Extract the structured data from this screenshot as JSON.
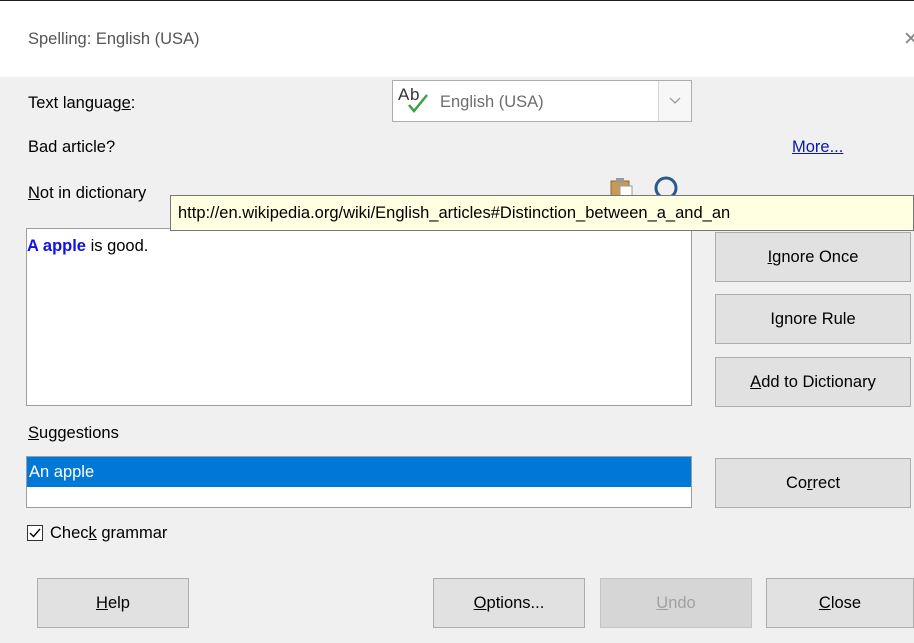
{
  "window": {
    "title": "Spelling: English (USA)",
    "close_glyph": "✕"
  },
  "text_language": {
    "label_pre": "Text languag",
    "label_u": "e",
    "label_post": ":",
    "value": "English (USA)",
    "icon": "spellcheck-abc-icon"
  },
  "error_desc": "Bad article?",
  "more_link": "More...",
  "not_in_dictionary": {
    "label_u": "N",
    "label_rest": "ot in dictionary"
  },
  "toolbar_icons": [
    "paste-icon",
    "search-icon"
  ],
  "editor": {
    "error_text": "A apple",
    "rest_text": " is good."
  },
  "tooltip": "http://en.wikipedia.org/wiki/English_articles#Distinction_between_a_and_an",
  "side_buttons": {
    "ignore_once": {
      "u": "I",
      "rest": "gnore Once"
    },
    "ignore_rule": {
      "pre": "I",
      "u": "g",
      "rest": "nore Rule"
    },
    "add_dictionary": {
      "u": "A",
      "rest": "dd to Dictionary"
    },
    "correct": {
      "pre": "Co",
      "u": "r",
      "rest": "rect"
    }
  },
  "suggestions": {
    "label_u": "S",
    "label_rest": "uggestions",
    "items": [
      "An apple"
    ]
  },
  "check_grammar": {
    "pre": "Chec",
    "u": "k",
    "rest": " grammar",
    "checked": true
  },
  "bottom_buttons": {
    "help": {
      "u": "H",
      "rest": "elp"
    },
    "options": {
      "u": "O",
      "rest": "ptions..."
    },
    "undo": {
      "u": "U",
      "rest": "ndo"
    },
    "close": {
      "u": "C",
      "rest": "lose"
    }
  },
  "colors": {
    "accent": "#0078d7",
    "error_word": "#1010e8",
    "link": "#0a1aa8",
    "tooltip_bg": "#ffffe1"
  }
}
